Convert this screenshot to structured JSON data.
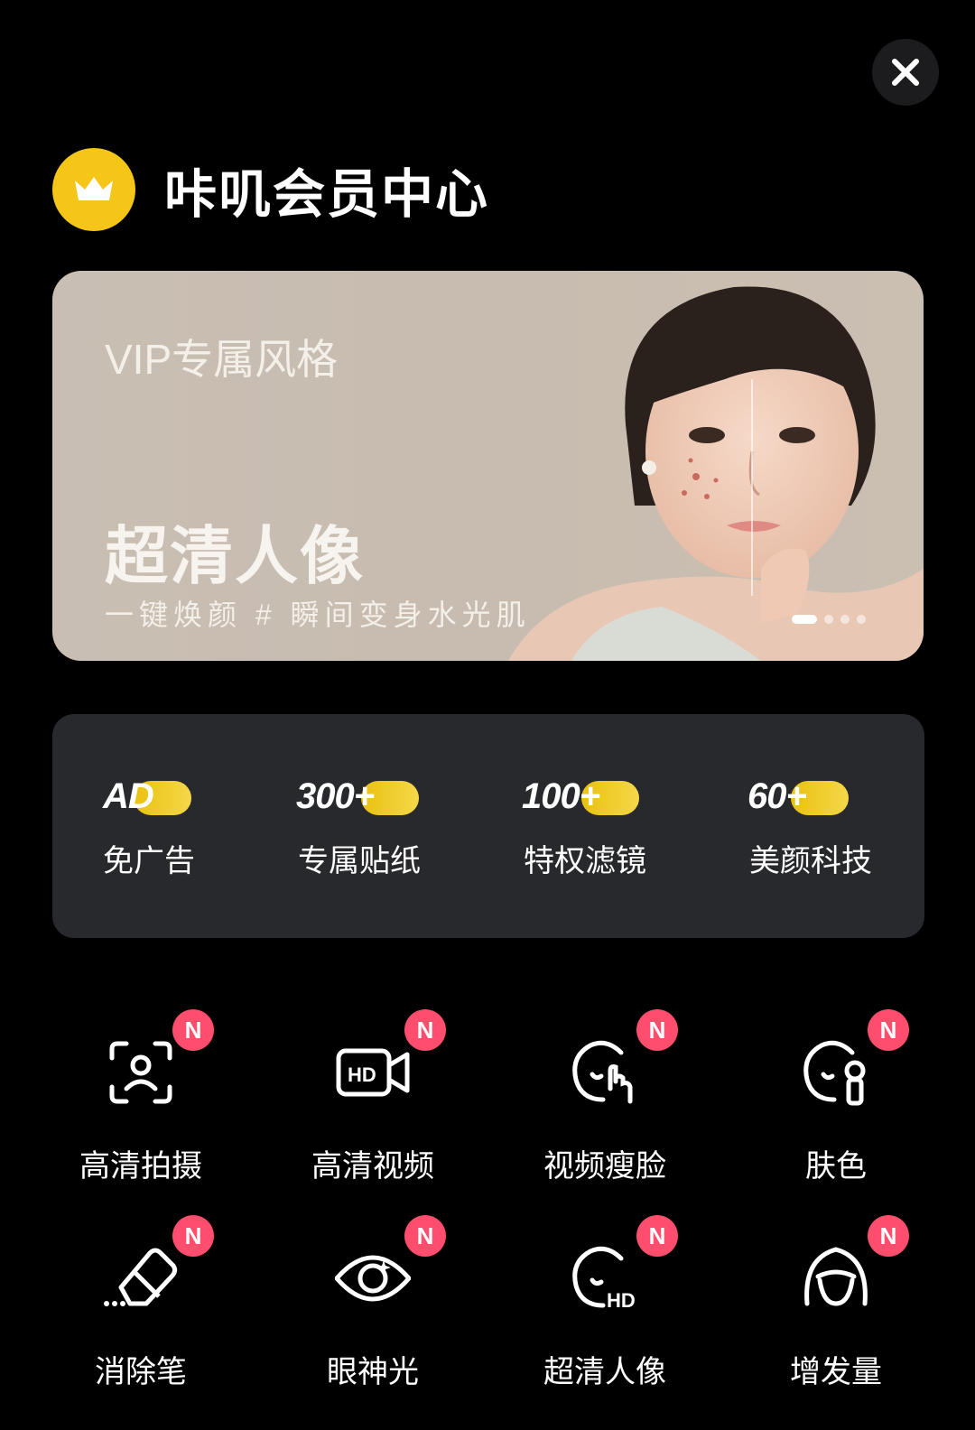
{
  "header": {
    "title": "咔叽会员中心"
  },
  "banner": {
    "tag": "VIP专属风格",
    "headline": "超清人像",
    "subtitle": "一键焕颜 # 瞬间变身水光肌",
    "page_count": 4,
    "active_page": 1
  },
  "perks": [
    {
      "badge": "AD",
      "label": "免广告"
    },
    {
      "badge": "300+",
      "label": "专属贴纸"
    },
    {
      "badge": "100+",
      "label": "特权滤镜"
    },
    {
      "badge": "60+",
      "label": "美颜科技"
    }
  ],
  "features": [
    {
      "label": "高清拍摄",
      "badge": "N",
      "icon": "face-scan-icon"
    },
    {
      "label": "高清视频",
      "badge": "N",
      "icon": "hd-video-icon"
    },
    {
      "label": "视频瘦脸",
      "badge": "N",
      "icon": "face-slim-icon"
    },
    {
      "label": "肤色",
      "badge": "N",
      "icon": "skin-tone-icon"
    },
    {
      "label": "消除笔",
      "badge": "N",
      "icon": "eraser-icon"
    },
    {
      "label": "眼神光",
      "badge": "N",
      "icon": "eye-light-icon"
    },
    {
      "label": "超清人像",
      "badge": "N",
      "icon": "hd-portrait-icon"
    },
    {
      "label": "增发量",
      "badge": "N",
      "icon": "hair-volume-icon"
    }
  ],
  "colors": {
    "accent": "#f5c518",
    "badge": "#ff4d6d",
    "panel": "#28292d",
    "banner": "#c9beb3"
  }
}
